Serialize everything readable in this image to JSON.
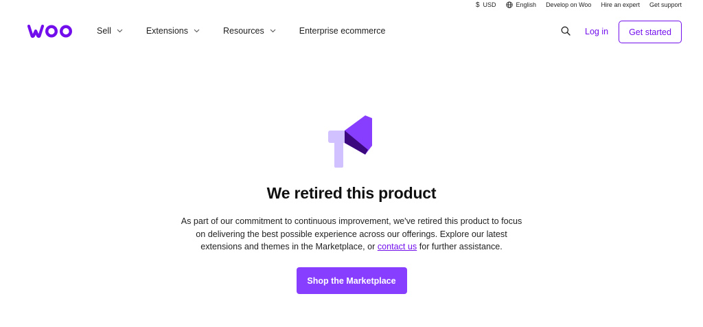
{
  "utility_bar": {
    "currency": "USD",
    "language": "English",
    "develop": "Develop on Woo",
    "hire": "Hire an expert",
    "support": "Get support"
  },
  "nav": {
    "logo_alt": "woo",
    "sell": "Sell",
    "extensions": "Extensions",
    "resources": "Resources",
    "enterprise": "Enterprise ecommerce",
    "login": "Log in",
    "get_started": "Get started"
  },
  "hero": {
    "title": "We retired this product",
    "desc_before": "As part of our commitment to continuous improvement, we've retired this product to focus on delivering the best possible experience across our offerings. Explore our latest extensions and themes in the Marketplace, or ",
    "desc_link": "contact us",
    "desc_after": " for further assistance.",
    "cta": "Shop the Marketplace"
  },
  "colors": {
    "brand": "#720eec",
    "button": "#873eff",
    "megaphone_light": "#d1c1ff",
    "megaphone_mid": "#873eff",
    "megaphone_dark": "#3c087e"
  },
  "icons": [
    "dollar-icon",
    "globe-icon",
    "chevron-down-icon",
    "search-icon",
    "megaphone-icon",
    "woo-logo"
  ]
}
